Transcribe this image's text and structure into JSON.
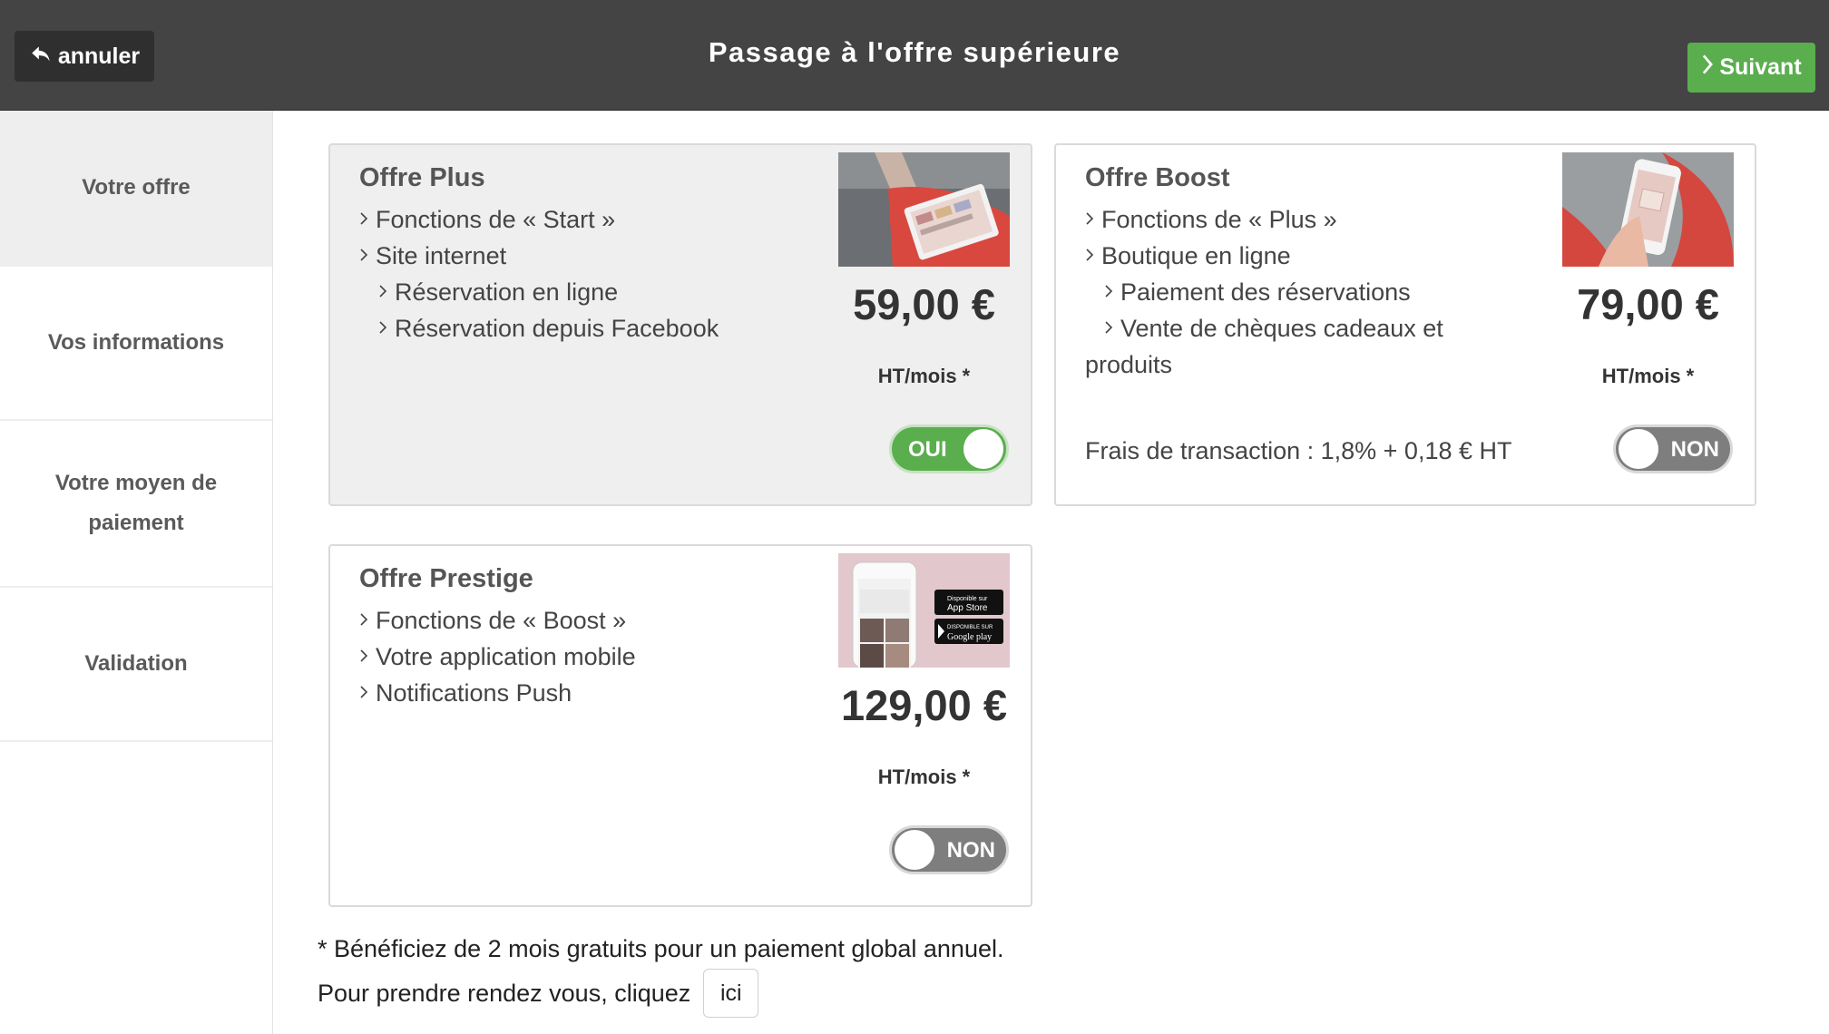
{
  "header": {
    "cancel_label": "annuler",
    "title": "Passage à l'offre supérieure",
    "next_label": "Suivant"
  },
  "sidebar": {
    "items": [
      {
        "label": "Votre offre",
        "active": true
      },
      {
        "label": "Vos informations",
        "active": false
      },
      {
        "label": "Votre moyen de paiement",
        "active": false
      },
      {
        "label": "Validation",
        "active": false
      }
    ]
  },
  "offers": [
    {
      "title": "Offre Plus",
      "features": [
        {
          "text": "Fonctions de « Start »",
          "level": 0
        },
        {
          "text": "Site internet",
          "level": 0
        },
        {
          "text": "Réservation en ligne",
          "level": 1
        },
        {
          "text": "Réservation depuis Facebook",
          "level": 1
        }
      ],
      "price": "59,00 €",
      "per": "HT/mois *",
      "toggle": "OUI",
      "enabled": true
    },
    {
      "title": "Offre Boost",
      "features": [
        {
          "text": "Fonctions de « Plus »",
          "level": 0
        },
        {
          "text": "Boutique en ligne",
          "level": 0
        },
        {
          "text": "Paiement des réservations",
          "level": 1
        },
        {
          "text": "Vente de chèques cadeaux et",
          "level": 1
        }
      ],
      "features_continuation": "produits",
      "fee": "Frais de transaction : 1,8% + 0,18 €  HT",
      "price": "79,00 €",
      "per": "HT/mois *",
      "toggle": "NON",
      "enabled": false
    },
    {
      "title": "Offre Prestige",
      "features": [
        {
          "text": "Fonctions de « Boost »",
          "level": 0
        },
        {
          "text": "Votre application mobile",
          "level": 0
        },
        {
          "text": "Notifications Push",
          "level": 0
        }
      ],
      "price": "129,00 €",
      "per": "HT/mois *",
      "toggle": "NON",
      "enabled": false,
      "badges": {
        "appstore_small": "Disponible sur",
        "appstore": "App Store",
        "gplay_small": "DISPONIBLE SUR",
        "gplay": "Google play"
      }
    }
  ],
  "footer": {
    "note": "* Bénéficiez de 2 mois gratuits pour un paiement global annuel.",
    "rdv_text": "Pour prendre rendez vous, cliquez",
    "ici_label": "ici"
  },
  "colors": {
    "header_bg": "#444444",
    "accent_green": "#5aae4e",
    "toggle_off": "#7e7e7e"
  },
  "icons": {
    "cancel": "reply-arrow-icon",
    "next": "chevron-right-icon"
  }
}
